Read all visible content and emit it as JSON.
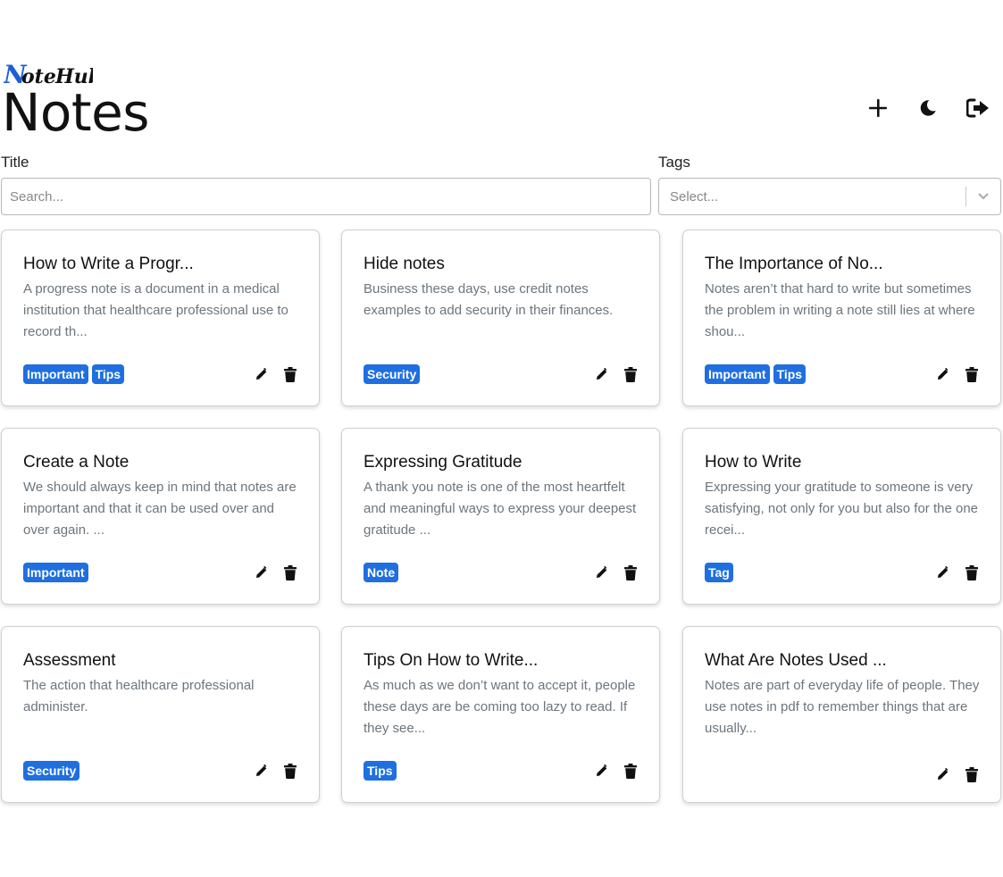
{
  "brand": {
    "logo_text": "NoteHub",
    "logo_color_primary": "#1f5fd6",
    "logo_color_secondary": "#111111"
  },
  "header": {
    "title": "Notes",
    "actions": [
      {
        "icon": "plus-icon"
      },
      {
        "icon": "moon-icon"
      },
      {
        "icon": "logout-icon"
      }
    ]
  },
  "filters": {
    "title_label": "Title",
    "title_placeholder": "Search...",
    "tags_label": "Tags",
    "tags_placeholder": "Select..."
  },
  "colors": {
    "accent": "#1f6fe0",
    "muted_text": "#6c757d"
  },
  "notes": [
    {
      "title": "How to Write a Progr...",
      "body": "A progress note is a document in a medical institution that healthcare professional use to record th...",
      "tags": [
        "Important",
        "Tips"
      ]
    },
    {
      "title": "Hide notes",
      "body": "Business these days, use credit notes examples to add security in their finances.",
      "tags": [
        "Security"
      ]
    },
    {
      "title": "The Importance of No...",
      "body": "Notes aren’t that hard to write but sometimes the problem in writing a note still lies at where shou...",
      "tags": [
        "Important",
        "Tips"
      ]
    },
    {
      "title": "Create a Note",
      "body": "We should always keep in mind that notes are important and that it can be used over and over again. ...",
      "tags": [
        "Important"
      ]
    },
    {
      "title": "Expressing Gratitude",
      "body": "A thank you note is one of the most heartfelt and meaningful ways to express your deepest gratitude ...",
      "tags": [
        "Note"
      ]
    },
    {
      "title": "How to Write",
      "body": "Expressing your gratitude to someone is very satisfying, not only for you but also for the one recei...",
      "tags": [
        "Tag"
      ]
    },
    {
      "title": "Assessment",
      "body": "The action that healthcare professional administer.",
      "tags": [
        "Security"
      ]
    },
    {
      "title": "Tips On How to Write...",
      "body": "As much as we don’t want to accept it, people these days are be coming too lazy to read. If they see...",
      "tags": [
        "Tips"
      ]
    },
    {
      "title": "What Are Notes Used ...",
      "body": "Notes are part of everyday life of people. They use notes in pdf to remember things that are usually...",
      "tags": []
    }
  ],
  "card_actions": {
    "edit_icon": "pencil-icon",
    "delete_icon": "trash-icon"
  }
}
